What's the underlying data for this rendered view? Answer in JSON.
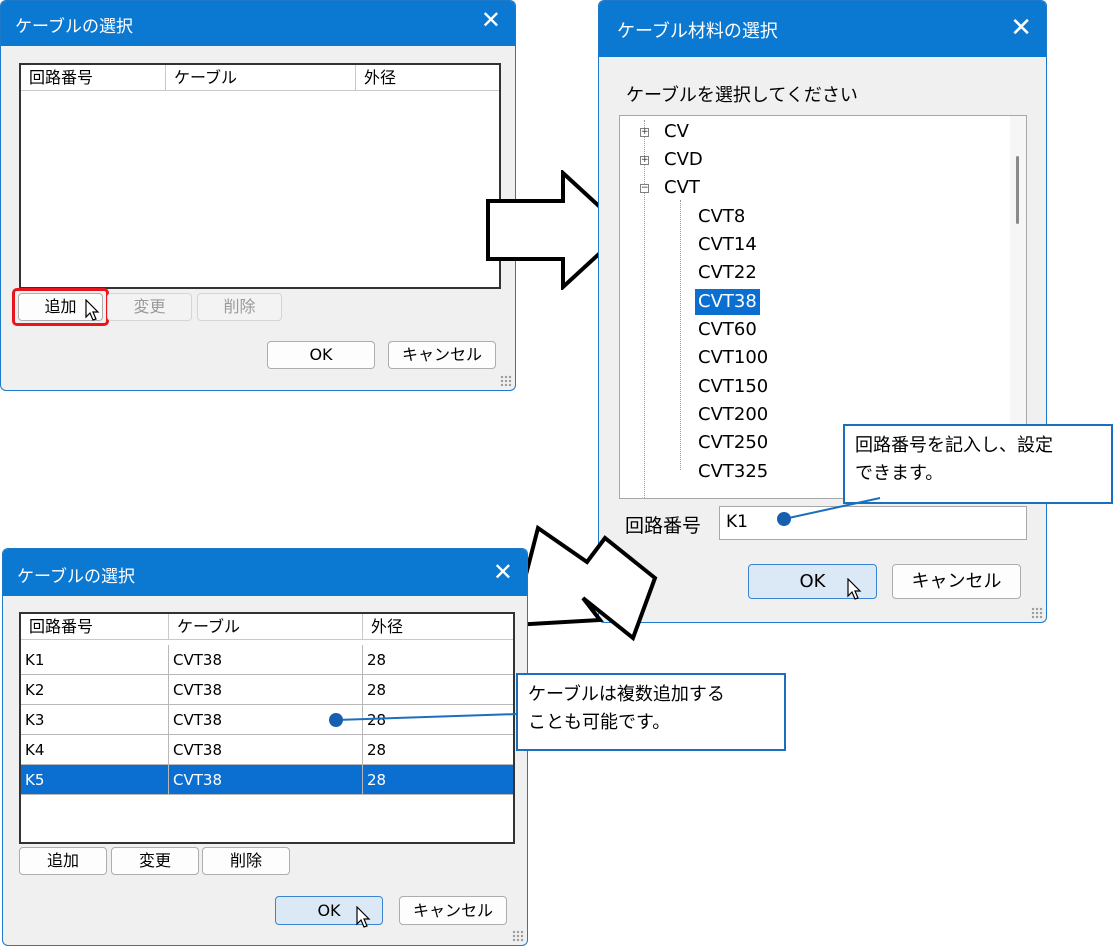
{
  "dialog1": {
    "title": "ケーブルの選択",
    "columns": [
      "回路番号",
      "ケーブル",
      "外径"
    ],
    "buttons": {
      "add": "追加",
      "change": "変更",
      "delete": "削除",
      "ok": "OK",
      "cancel": "キャンセル"
    }
  },
  "dialog2": {
    "title": "ケーブル材料の選択",
    "prompt": "ケーブルを選択してください",
    "tree": {
      "top": [
        "CV",
        "CVD",
        "CVT"
      ],
      "children": [
        "CVT8",
        "CVT14",
        "CVT22",
        "CVT38",
        "CVT60",
        "CVT100",
        "CVT150",
        "CVT200",
        "CVT250",
        "CVT325"
      ],
      "selected": "CVT38"
    },
    "circuit_label": "回路番号",
    "circuit_value": "K1",
    "buttons": {
      "ok": "OK",
      "cancel": "キャンセル"
    }
  },
  "dialog3": {
    "title": "ケーブルの選択",
    "columns": [
      "回路番号",
      "ケーブル",
      "外径"
    ],
    "rows": [
      {
        "circuit": "K1",
        "cable": "CVT38",
        "diameter": "28"
      },
      {
        "circuit": "K2",
        "cable": "CVT38",
        "diameter": "28"
      },
      {
        "circuit": "K3",
        "cable": "CVT38",
        "diameter": "28"
      },
      {
        "circuit": "K4",
        "cable": "CVT38",
        "diameter": "28"
      },
      {
        "circuit": "K5",
        "cable": "CVT38",
        "diameter": "28"
      }
    ],
    "selected_row": "K5",
    "buttons": {
      "add": "追加",
      "change": "変更",
      "delete": "削除",
      "ok": "OK",
      "cancel": "キャンセル"
    }
  },
  "callouts": {
    "circuit": [
      "回路番号を記入し、設定",
      "できます。"
    ],
    "multiple": [
      "ケーブルは複数追加する",
      "ことも可能です。"
    ]
  },
  "colors": {
    "titlebar": "#0b78d2",
    "selection": "#0a6fd0",
    "highlight_box": "#e8141e",
    "callout_border": "#1b6fbd"
  }
}
